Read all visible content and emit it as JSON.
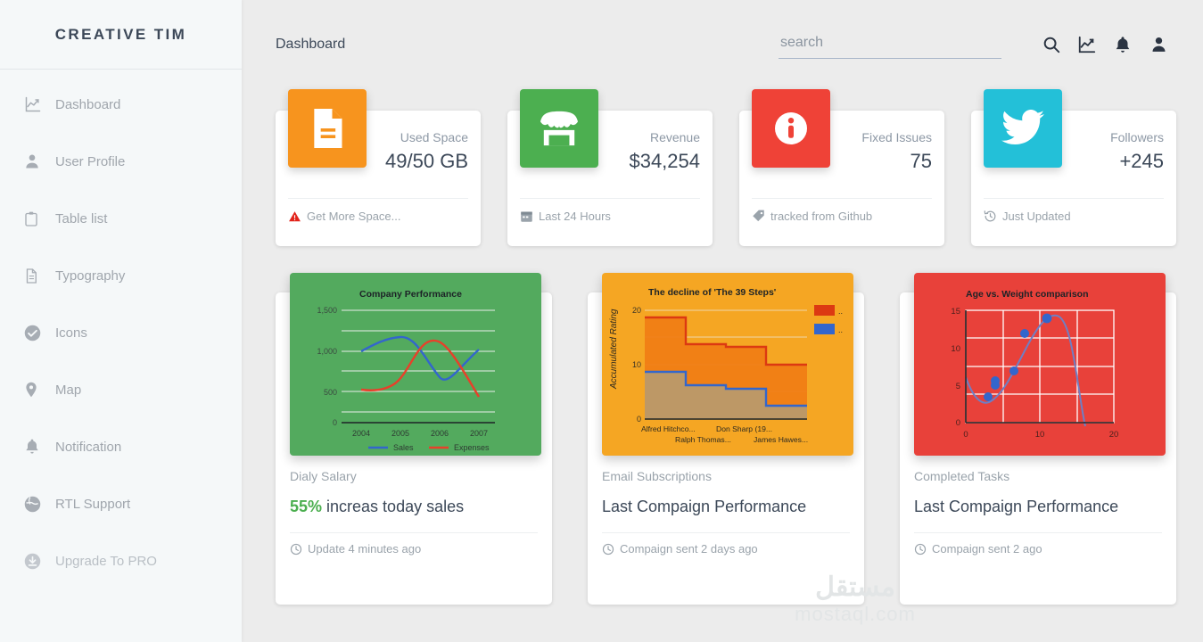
{
  "sidebar": {
    "brand": "CREATIVE TIM",
    "items": [
      {
        "label": "Dashboard",
        "icon": "chart-line-icon"
      },
      {
        "label": "User Profile",
        "icon": "user-icon"
      },
      {
        "label": "Table list",
        "icon": "clipboard-icon"
      },
      {
        "label": "Typography",
        "icon": "document-icon"
      },
      {
        "label": "Icons",
        "icon": "check-circle-icon"
      },
      {
        "label": "Map",
        "icon": "map-pin-icon"
      },
      {
        "label": "Notification",
        "icon": "bell-icon"
      },
      {
        "label": "RTL Support",
        "icon": "globe-icon"
      },
      {
        "label": "Upgrade To PRO",
        "icon": "download-circle-icon"
      }
    ]
  },
  "topbar": {
    "title": "Dashboard",
    "search": {
      "value": "",
      "placeholder": "search"
    },
    "actions": [
      {
        "name": "search-icon"
      },
      {
        "name": "dashboard-chart-icon"
      },
      {
        "name": "bell-icon"
      },
      {
        "name": "person-icon"
      }
    ]
  },
  "stats": [
    {
      "label": "Used Space",
      "value": "49/50 GB",
      "footer": "Get More Space...",
      "footer_icon": "warning-icon",
      "icon": "file-document-icon",
      "color": "#f7941e"
    },
    {
      "label": "Revenue",
      "value": "$34,254",
      "footer": "Last 24 Hours",
      "footer_icon": "calendar-icon",
      "icon": "store-icon",
      "color": "#4caf50"
    },
    {
      "label": "Fixed Issues",
      "value": "75",
      "footer": "tracked from Github",
      "footer_icon": "tag-icon",
      "icon": "info-circle-icon",
      "color": "#ef4237"
    },
    {
      "label": "Followers",
      "value": "+245",
      "footer": "Just Updated",
      "footer_icon": "history-icon",
      "icon": "twitter-bird-icon",
      "color": "#23c0d8"
    }
  ],
  "chart_cards": [
    {
      "subtitle": "Dialy Salary",
      "title_highlight": "55%",
      "title_rest": " increas today sales",
      "footer": "Update 4 minutes ago",
      "footer_icon": "clock-icon",
      "panel_color": "#53aa5e"
    },
    {
      "subtitle": "Email Subscriptions",
      "title_highlight": "",
      "title_rest": "Last Compaign Performance",
      "footer": "Compaign sent 2 days ago",
      "footer_icon": "clock-icon",
      "panel_color": "#f5a623"
    },
    {
      "subtitle": "Completed Tasks",
      "title_highlight": "",
      "title_rest": "Last Compaign Performance",
      "footer": "Compaign sent 2 ago",
      "footer_icon": "clock-icon",
      "panel_color": "#e8413a"
    }
  ],
  "chart_data": [
    {
      "type": "line",
      "title": "Company Performance",
      "xlabel": "",
      "ylabel": "",
      "categories": [
        "2004",
        "2005",
        "2006",
        "2007"
      ],
      "x": [
        2004,
        2005,
        2006,
        2007
      ],
      "ylim": [
        0,
        1500
      ],
      "yticks": [
        0,
        500,
        1000,
        1500
      ],
      "ytick_labels": [
        "0",
        "500",
        "1,000",
        "1,500"
      ],
      "grid": true,
      "legend_position": "bottom",
      "background": "#53aa5e",
      "series": [
        {
          "name": "Sales",
          "color": "#3366cc",
          "values": [
            1000,
            1180,
            680,
            1030
          ]
        },
        {
          "name": "Expenses",
          "color": "#e8402a",
          "values": [
            400,
            430,
            1130,
            550
          ]
        }
      ]
    },
    {
      "type": "area",
      "title": "The decline of 'The 39 Steps'",
      "xlabel": "",
      "ylabel": "Accumulated Rating",
      "categories": [
        "Alfred Hitchco...",
        "Ralph Thomas...",
        "Don Sharp (19...",
        "James Hawes..."
      ],
      "ylim": [
        0,
        20
      ],
      "yticks": [
        0,
        10,
        20
      ],
      "ytick_labels": [
        "0",
        "10",
        "20"
      ],
      "grid": true,
      "legend_position": "right",
      "legend_entries": [
        "..",
        ".."
      ],
      "background": "#f5a623",
      "stepped": true,
      "series": [
        {
          "name": "..",
          "color": "#dc3912",
          "values": [
            16.5,
            13.7,
            13.3,
            10.8
          ]
        },
        {
          "name": "..",
          "color": "#3366cc",
          "values": [
            8.7,
            7.0,
            6.6,
            4.6
          ]
        }
      ]
    },
    {
      "type": "scatter",
      "title": "Age vs. Weight comparison",
      "xlabel": "",
      "ylabel": "",
      "xlim": [
        0,
        20
      ],
      "ylim": [
        0,
        15
      ],
      "xticks": [
        0,
        10,
        20
      ],
      "xtick_labels": [
        "0",
        "10",
        "20"
      ],
      "yticks": [
        0,
        5,
        10,
        15
      ],
      "ytick_labels": [
        "0",
        "5",
        "10",
        "15"
      ],
      "grid": true,
      "background": "#e8413a",
      "point_color": "#3366cc",
      "trendline": true,
      "points": [
        {
          "x": 3,
          "y": 3.5
        },
        {
          "x": 4,
          "y": 5.0
        },
        {
          "x": 4,
          "y": 5.5
        },
        {
          "x": 6.5,
          "y": 7.0
        },
        {
          "x": 8,
          "y": 12.0
        },
        {
          "x": 11,
          "y": 14.0
        }
      ]
    }
  ],
  "watermark": {
    "arabic": "مستقل",
    "latin": "mostaql.com"
  }
}
